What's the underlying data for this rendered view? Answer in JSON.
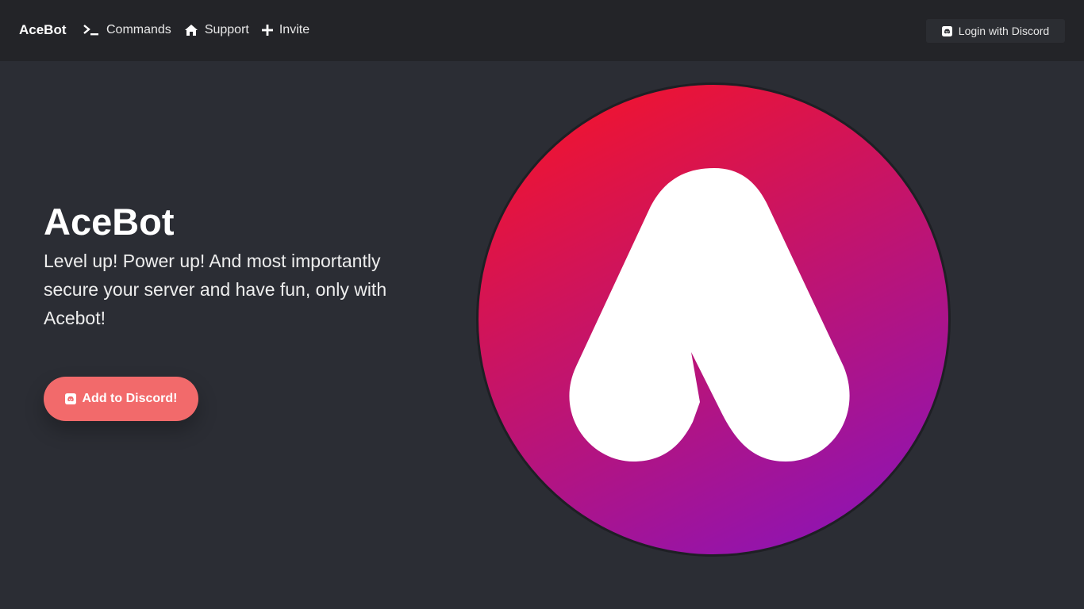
{
  "navbar": {
    "brand": "AceBot",
    "links": [
      {
        "label": "Commands",
        "icon": "terminal-icon"
      },
      {
        "label": "Support",
        "icon": "home-icon"
      },
      {
        "label": "Invite",
        "icon": "plus-icon"
      }
    ],
    "login_label": "Login with Discord",
    "login_icon": "discord-icon"
  },
  "hero": {
    "title": "AceBot",
    "subtitle": "Level up! Power up! And most importantly secure your server and have fun, only with Acebot!",
    "cta_label": "Add to Discord!",
    "cta_icon": "discord-icon"
  },
  "logo": {
    "letter": "A",
    "gradient_start": "#f0142f",
    "gradient_end": "#8e14b3"
  },
  "colors": {
    "background": "#2b2d34",
    "navbar": "#232428",
    "accent": "#f26a6b"
  }
}
